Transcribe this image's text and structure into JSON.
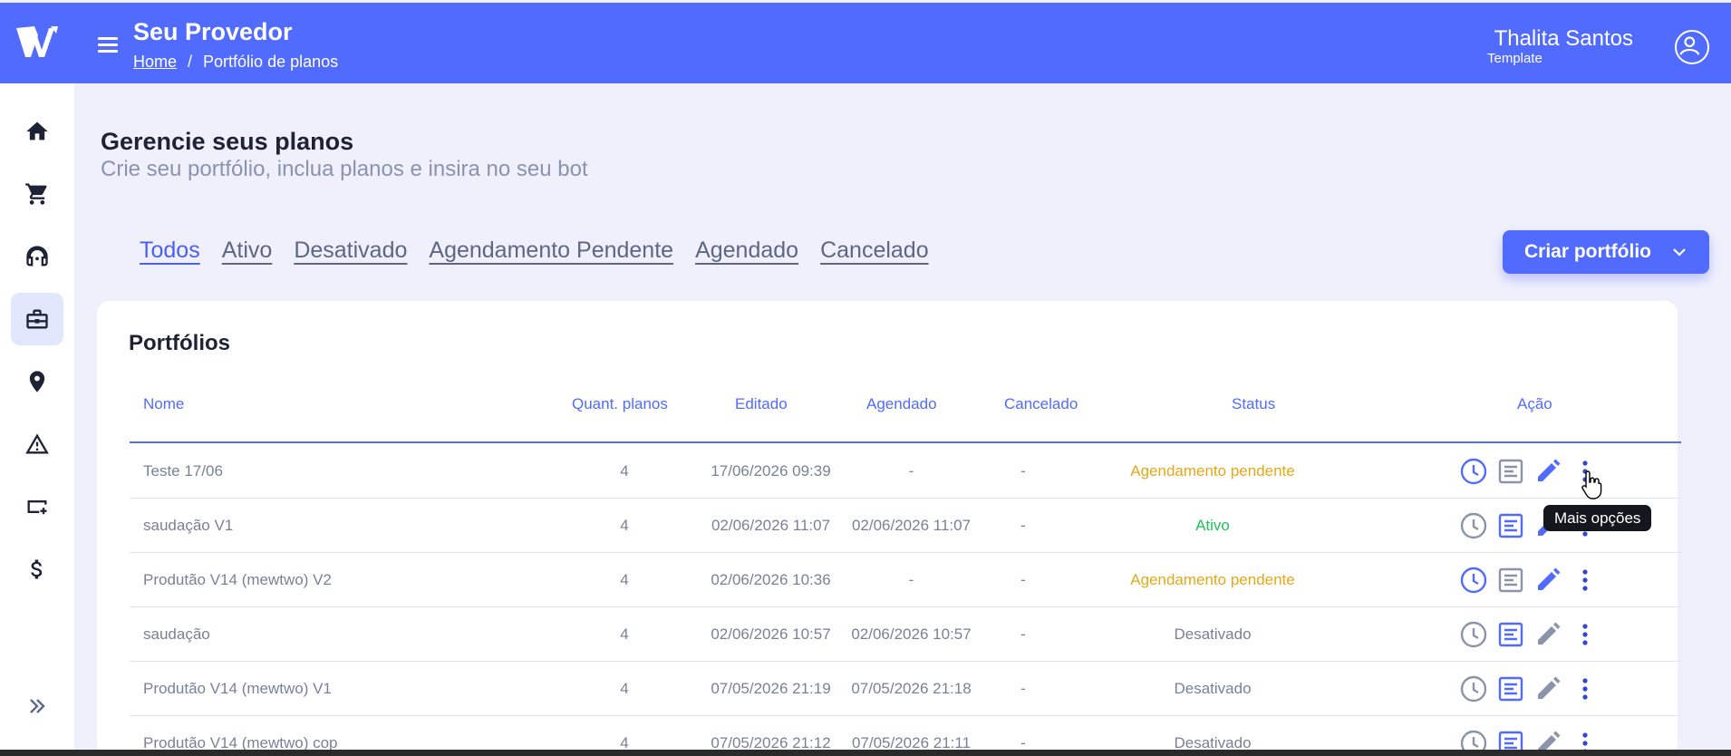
{
  "header": {
    "app_title": "Seu Provedor",
    "breadcrumb": {
      "home": "Home",
      "separator": "/",
      "current": "Portfólio de planos"
    },
    "user": {
      "name": "Thalita Santos",
      "role": "Template"
    }
  },
  "sidebar": {
    "items": [
      {
        "name": "home",
        "icon": "home-icon"
      },
      {
        "name": "cart",
        "icon": "cart-icon"
      },
      {
        "name": "support",
        "icon": "headset-icon"
      },
      {
        "name": "portfolio",
        "icon": "briefcase-icon",
        "active": true
      },
      {
        "name": "location",
        "icon": "location-pin-icon"
      },
      {
        "name": "alerts",
        "icon": "warning-icon"
      },
      {
        "name": "plans",
        "icon": "card-plus-icon"
      },
      {
        "name": "finance",
        "icon": "dollar-icon"
      }
    ],
    "expand_icon": "double-chevron-right-icon"
  },
  "page": {
    "title": "Gerencie seus planos",
    "subtitle": "Crie seu portfólio, inclua planos e insira no seu bot"
  },
  "tabs": [
    "Todos",
    "Ativo",
    "Desativado",
    "Agendamento Pendente",
    "Agendado",
    "Cancelado"
  ],
  "active_tab": "Todos",
  "create_button": {
    "label": "Criar portfólio"
  },
  "table": {
    "title": "Portfólios",
    "columns": [
      "Nome",
      "Quant. planos",
      "Editado",
      "Agendado",
      "Cancelado",
      "Status",
      "Ação"
    ],
    "rows": [
      {
        "name": "Teste 17/06",
        "qty": "4",
        "edited": "17/06/2026 09:39",
        "scheduled": "-",
        "cancelled": "-",
        "status": "Agendamento pendente",
        "status_kind": "pending"
      },
      {
        "name": "saudação V1",
        "qty": "4",
        "edited": "02/06/2026 11:07",
        "scheduled": "02/06/2026 11:07",
        "cancelled": "-",
        "status": "Ativo",
        "status_kind": "active"
      },
      {
        "name": "Produtão V14 (mewtwo) V2",
        "qty": "4",
        "edited": "02/06/2026 10:36",
        "scheduled": "-",
        "cancelled": "-",
        "status": "Agendamento pendente",
        "status_kind": "pending"
      },
      {
        "name": "saudação",
        "qty": "4",
        "edited": "02/06/2026 10:57",
        "scheduled": "02/06/2026 10:57",
        "cancelled": "-",
        "status": "Desativado",
        "status_kind": "off"
      },
      {
        "name": "Produtão V14 (mewtwo) V1",
        "qty": "4",
        "edited": "07/05/2026 21:19",
        "scheduled": "07/05/2026 21:18",
        "cancelled": "-",
        "status": "Desativado",
        "status_kind": "off"
      },
      {
        "name": "Produtão V14 (mewtwo) cop",
        "qty": "4",
        "edited": "07/05/2026 21:12",
        "scheduled": "07/05/2026 21:11",
        "cancelled": "-",
        "status": "Desativado",
        "status_kind": "off"
      }
    ]
  },
  "tooltip": "Mais opções",
  "colors": {
    "primary": "#516bff",
    "pending": "#e5a816",
    "active": "#1ec45a",
    "muted": "#7a8197",
    "page_bg": "#f0f0fd"
  }
}
